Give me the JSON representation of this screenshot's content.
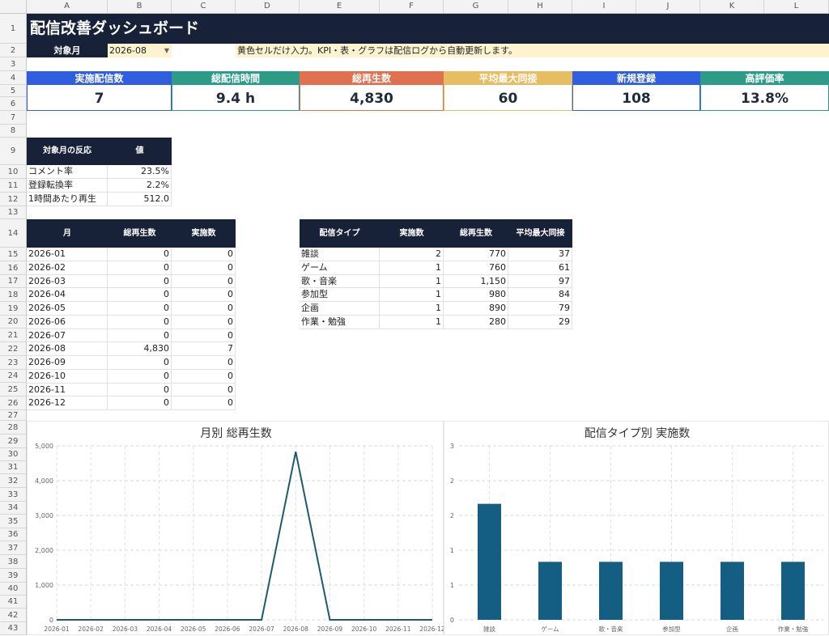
{
  "columns": [
    "A",
    "B",
    "C",
    "D",
    "E",
    "F",
    "G",
    "H",
    "I",
    "J",
    "K",
    "L"
  ],
  "rows": [
    "1",
    "2",
    "3",
    "4",
    "5",
    "6",
    "7",
    "8",
    "9",
    "10",
    "11",
    "12",
    "13",
    "14",
    "15",
    "16",
    "17",
    "18",
    "19",
    "20",
    "21",
    "22",
    "23",
    "24",
    "25",
    "26",
    "27",
    "28",
    "29",
    "30",
    "31",
    "32",
    "33",
    "34",
    "35",
    "36",
    "37",
    "38",
    "39",
    "40",
    "41",
    "42",
    "43"
  ],
  "title": "配信改善ダッシュボード",
  "target_month": {
    "label": "対象月",
    "value": "2026-08",
    "dropdown_icon": "▼"
  },
  "note": "黄色セルだけ入力。KPI・表・グラフは配信ログから自動更新します。",
  "kpis": [
    {
      "label": "実施配信数",
      "value": "7",
      "color": "#2f5fe0"
    },
    {
      "label": "総配信時間",
      "value": "9.4 h",
      "color": "#2c9c89"
    },
    {
      "label": "総再生数",
      "value": "4,830",
      "color": "#e07150"
    },
    {
      "label": "平均最大同接",
      "value": "60",
      "color": "#e6bd63"
    },
    {
      "label": "新規登録",
      "value": "108",
      "color": "#2f5fe0"
    },
    {
      "label": "高評価率",
      "value": "13.8%",
      "color": "#2c9c89"
    }
  ],
  "reaction": {
    "headers": [
      "対象月の反応",
      "値"
    ],
    "rows": [
      [
        "コメント率",
        "23.5%"
      ],
      [
        "登録転換率",
        "2.2%"
      ],
      [
        "1時間あたり再生",
        "512.0"
      ]
    ]
  },
  "monthly": {
    "headers": [
      "月",
      "総再生数",
      "実施数"
    ],
    "rows": [
      [
        "2026-01",
        "0",
        "0"
      ],
      [
        "2026-02",
        "0",
        "0"
      ],
      [
        "2026-03",
        "0",
        "0"
      ],
      [
        "2026-04",
        "0",
        "0"
      ],
      [
        "2026-05",
        "0",
        "0"
      ],
      [
        "2026-06",
        "0",
        "0"
      ],
      [
        "2026-07",
        "0",
        "0"
      ],
      [
        "2026-08",
        "4,830",
        "7"
      ],
      [
        "2026-09",
        "0",
        "0"
      ],
      [
        "2026-10",
        "0",
        "0"
      ],
      [
        "2026-11",
        "0",
        "0"
      ],
      [
        "2026-12",
        "0",
        "0"
      ]
    ]
  },
  "types": {
    "headers": [
      "配信タイプ",
      "実施数",
      "総再生数",
      "平均最大同接"
    ],
    "rows": [
      [
        "雑談",
        "2",
        "770",
        "37"
      ],
      [
        "ゲーム",
        "1",
        "760",
        "61"
      ],
      [
        "歌・音楽",
        "1",
        "1,150",
        "97"
      ],
      [
        "参加型",
        "1",
        "980",
        "84"
      ],
      [
        "企画",
        "1",
        "890",
        "79"
      ],
      [
        "作業・勉強",
        "1",
        "280",
        "29"
      ]
    ]
  },
  "chart_data": [
    {
      "type": "line",
      "title": "月別 総再生数",
      "x": [
        "2026-01",
        "2026-02",
        "2026-03",
        "2026-04",
        "2026-05",
        "2026-06",
        "2026-07",
        "2026-08",
        "2026-09",
        "2026-10",
        "2026-11",
        "2026-12"
      ],
      "values": [
        0,
        0,
        0,
        0,
        0,
        0,
        0,
        4830,
        0,
        0,
        0,
        0
      ],
      "yticks": [
        "0",
        "1,000",
        "2,000",
        "3,000",
        "4,000",
        "5,000"
      ],
      "ylim": [
        0,
        5000
      ],
      "grid": true,
      "color": "#1d5a70"
    },
    {
      "type": "bar",
      "title": "配信タイプ別 実施数",
      "categories": [
        "雑談",
        "ゲーム",
        "歌・音楽",
        "参加型",
        "企画",
        "作業・勉強"
      ],
      "values": [
        2,
        1,
        1,
        1,
        1,
        1
      ],
      "yticks": [
        "0",
        "1",
        "1",
        "2",
        "2",
        "3"
      ],
      "ylim": [
        0,
        3
      ],
      "grid": true,
      "color": "#155e83"
    }
  ]
}
